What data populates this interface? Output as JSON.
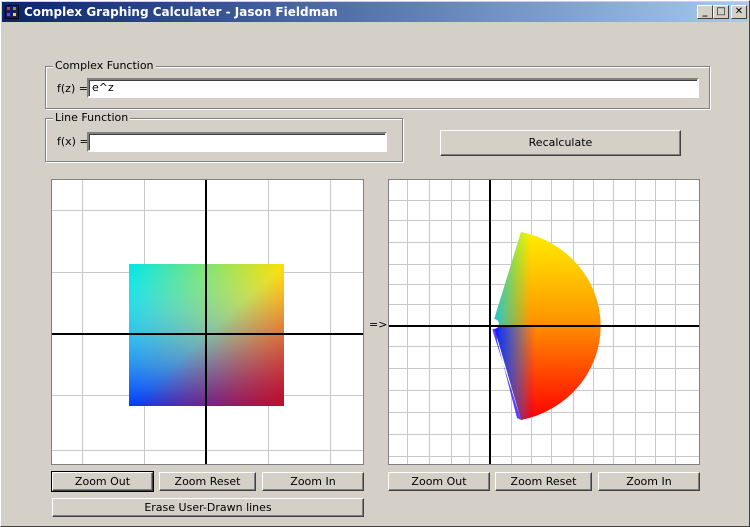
{
  "window": {
    "title": "Complex Graphing Calculater - Jason Fieldman",
    "controls": {
      "minimize": "_",
      "maximize": "□",
      "close": "✕"
    }
  },
  "complex_group": {
    "legend": "Complex Function",
    "label": "f(z) =",
    "value": "e^z"
  },
  "line_group": {
    "legend": "Line Function",
    "label": "f(x) =",
    "value": ""
  },
  "recalculate_label": "Recalculate",
  "mapping_arrow": "=>",
  "left_plot": {
    "buttons": {
      "zoom_out": "Zoom Out",
      "zoom_reset": "Zoom Reset",
      "zoom_in": "Zoom In"
    }
  },
  "right_plot": {
    "buttons": {
      "zoom_out": "Zoom Out",
      "zoom_reset": "Zoom Reset",
      "zoom_in": "Zoom In"
    }
  },
  "erase_label": "Erase User-Drawn lines"
}
